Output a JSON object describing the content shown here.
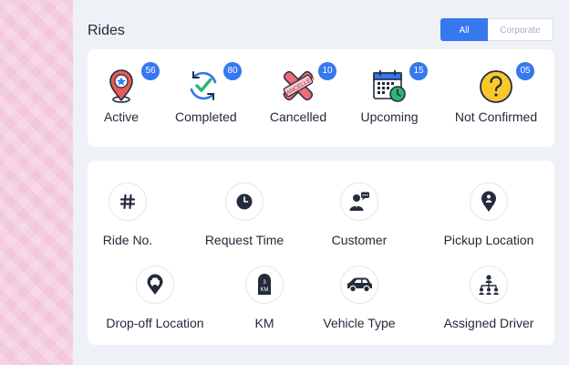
{
  "page": {
    "title": "Rides"
  },
  "toggle": {
    "all_label": "All",
    "corporate_label": "Corporate",
    "selected": "All"
  },
  "stats": [
    {
      "label": "Active",
      "count": "56",
      "icon": "location-star-icon"
    },
    {
      "label": "Completed",
      "count": "80",
      "icon": "refresh-check-icon"
    },
    {
      "label": "Cancelled",
      "count": "10",
      "icon": "cancelled-x-icon"
    },
    {
      "label": "Upcoming",
      "count": "15",
      "icon": "calendar-clock-icon"
    },
    {
      "label": "Not Confirmed",
      "count": "05",
      "icon": "question-circle-icon"
    }
  ],
  "fields": [
    {
      "label": "Ride No.",
      "icon": "hash-icon"
    },
    {
      "label": "Request Time",
      "icon": "clock-icon"
    },
    {
      "label": "Customer",
      "icon": "customer-chat-icon"
    },
    {
      "label": "Pickup Location",
      "icon": "pickup-pin-icon"
    },
    {
      "label": "Drop-off Location",
      "icon": "dropoff-car-pin-icon"
    },
    {
      "label": "KM",
      "icon": "km-signpost-icon",
      "icon_text_top": "3",
      "icon_text_bottom": "KM"
    },
    {
      "label": "Vehicle Type",
      "icon": "car-icon"
    },
    {
      "label": "Assigned Driver",
      "icon": "org-chart-icon"
    }
  ],
  "colors": {
    "accent": "#3578f0",
    "dark_icon": "#232c3d",
    "text": "#222a3a",
    "side_strip": "#f2c7dc",
    "background": "#eef1f6"
  }
}
